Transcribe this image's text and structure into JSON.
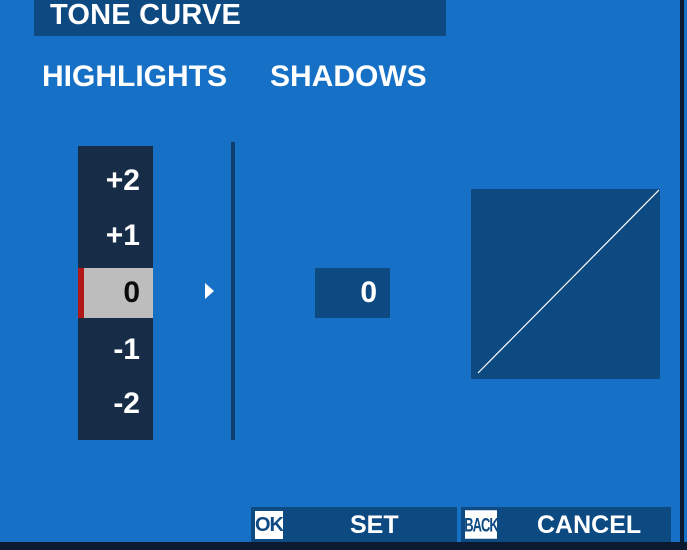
{
  "title": "TONE CURVE",
  "tabs": {
    "highlights": "HIGHLIGHTS",
    "shadows": "SHADOWS"
  },
  "highlights_scale": {
    "items": [
      "+2",
      "+1",
      "0",
      "-1",
      "-2"
    ],
    "selected_index": 2,
    "selected_value": "0"
  },
  "shadows_value": "0",
  "curve": {
    "shape": "linear",
    "icon": "tone-curve-graph"
  },
  "buttons": {
    "set": {
      "badge": "OK",
      "label": "SET"
    },
    "cancel": {
      "badge": "BACK",
      "label": "CANCEL"
    }
  },
  "colors": {
    "background": "#1570c6",
    "panel": "#0e4a82",
    "scale_background": "#162c47",
    "selected_row": "#bdbdbd",
    "selection_marker": "#b21818",
    "text": "#ffffff"
  }
}
